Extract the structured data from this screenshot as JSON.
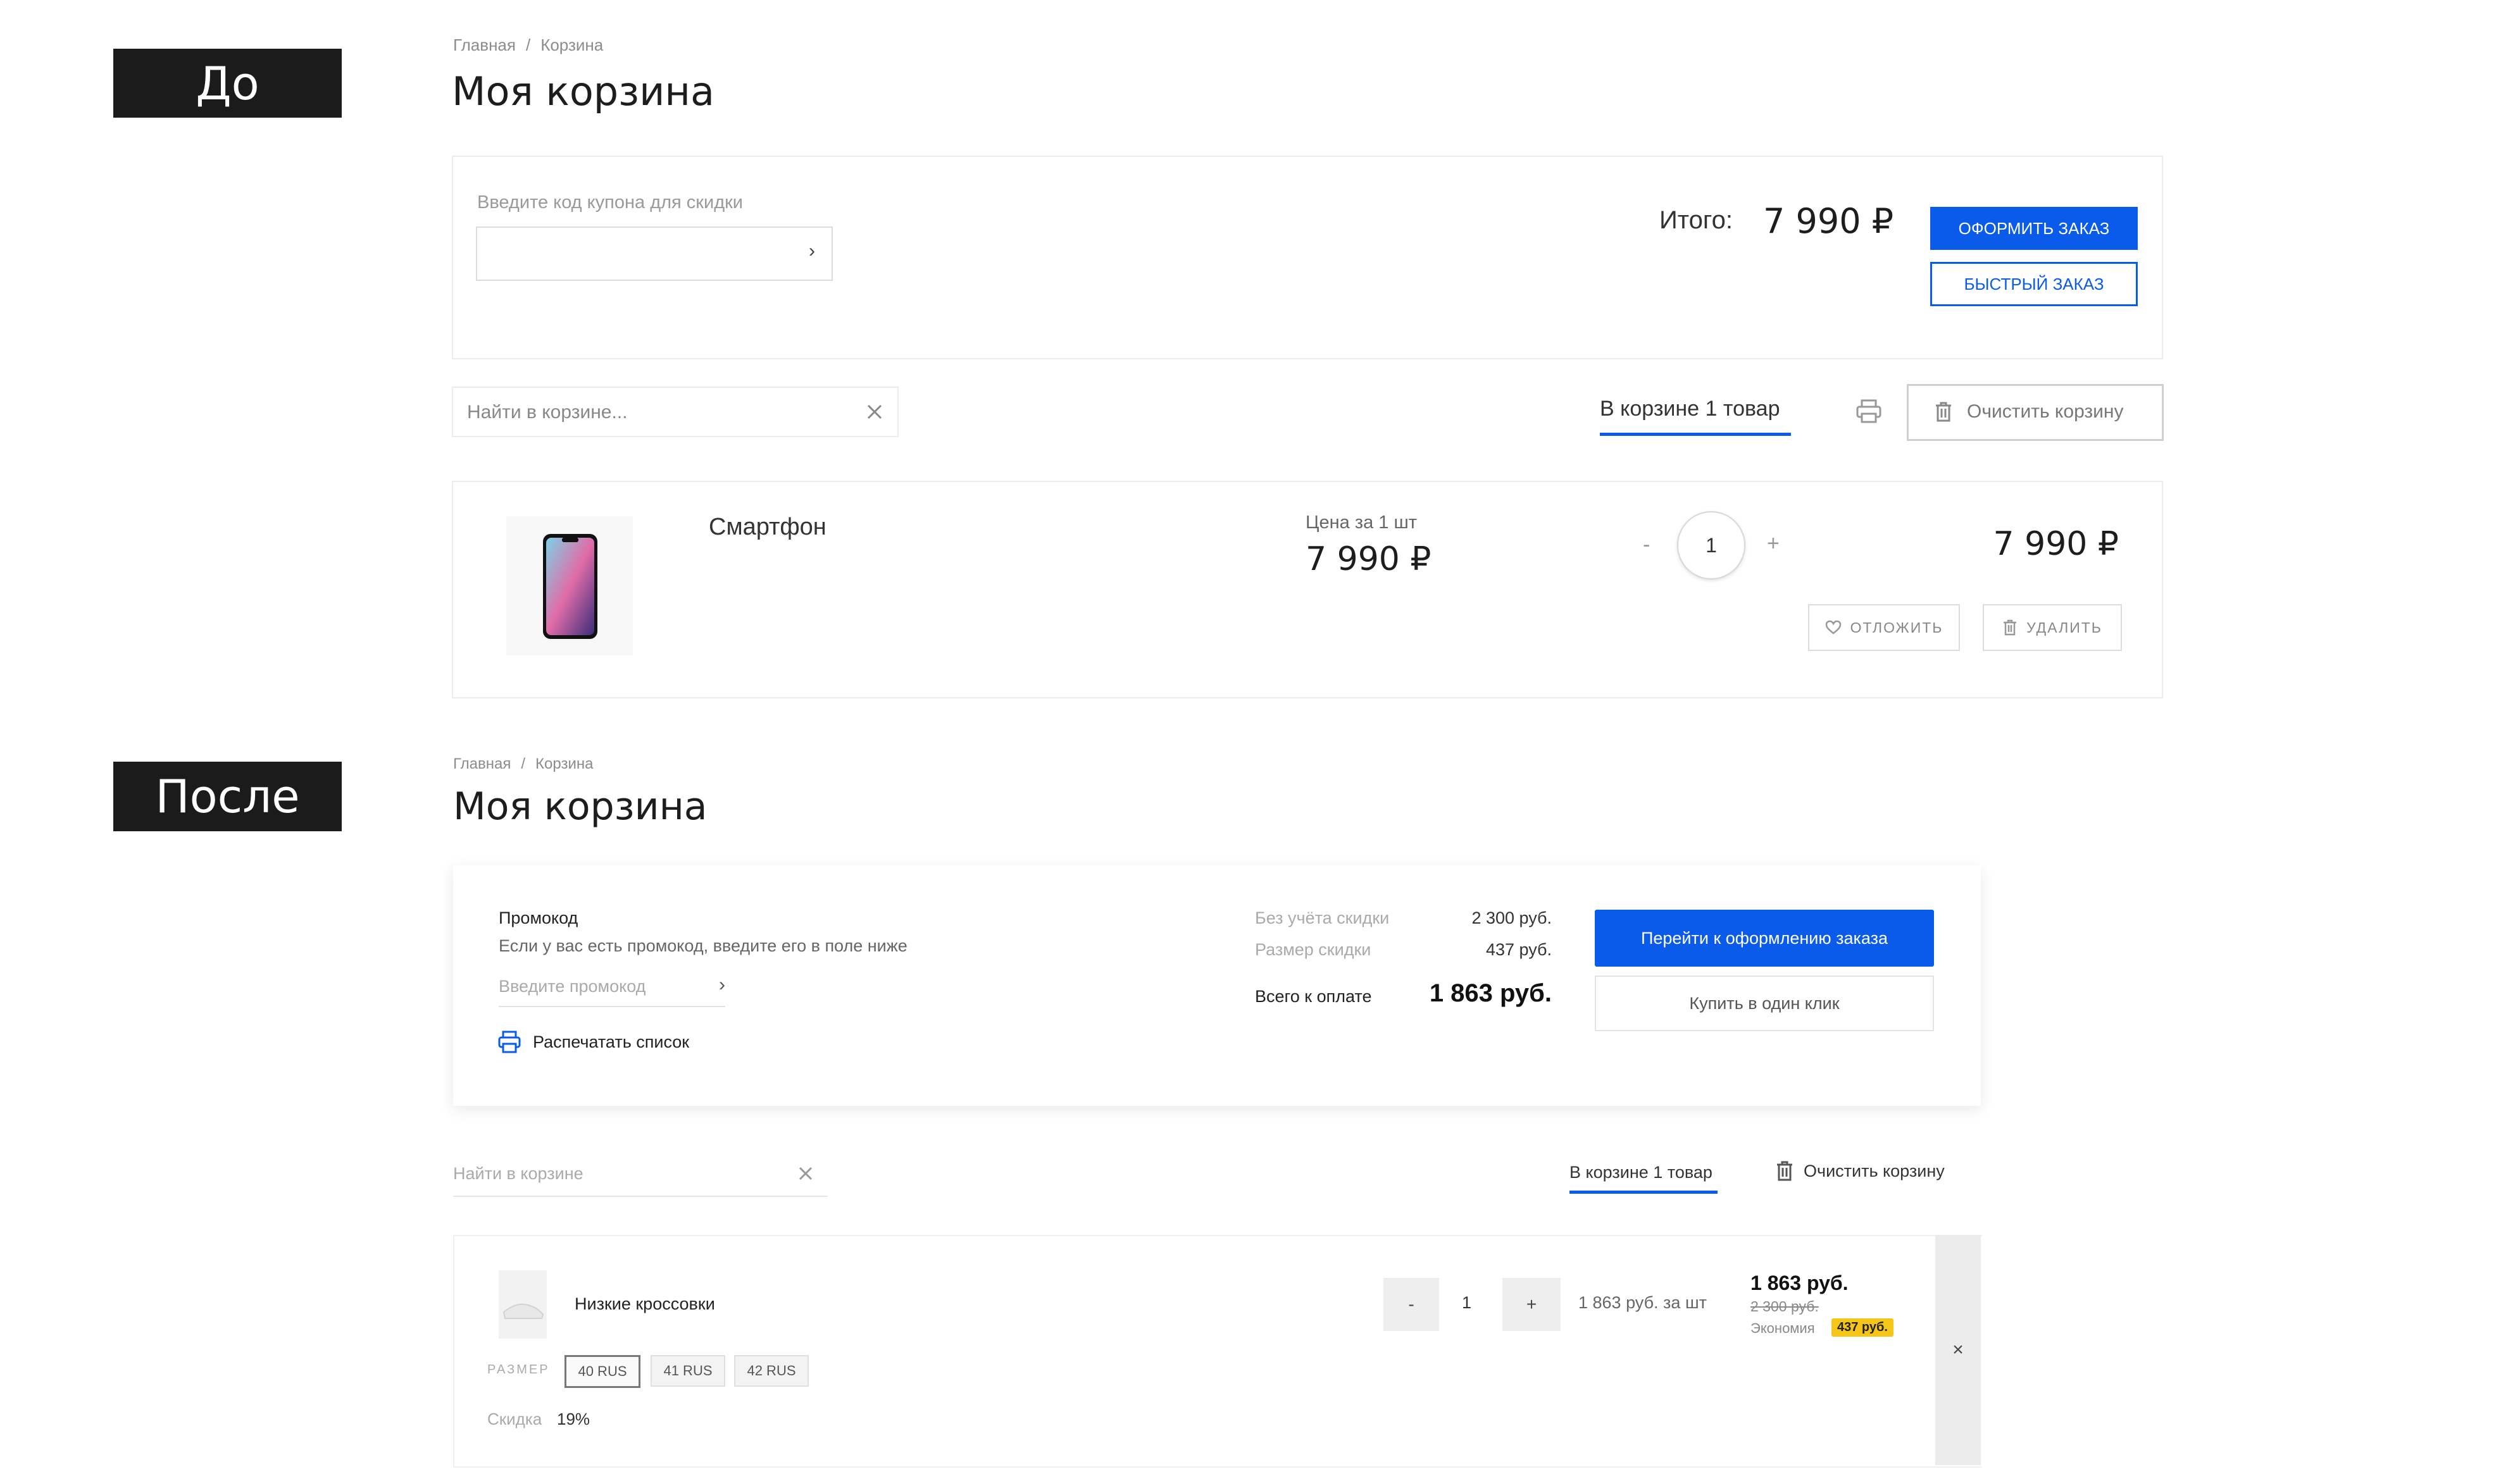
{
  "labels": {
    "before": "До",
    "after": "После"
  },
  "before": {
    "breadcrumbs": [
      "Главная",
      "Корзина"
    ],
    "title": "Моя корзина",
    "coupon": {
      "label": "Введите код купона для скидки",
      "value": ""
    },
    "total": {
      "label": "Итого:",
      "value": "7 990 ₽"
    },
    "buttons": {
      "checkout": "ОФОРМИТЬ ЗАКАЗ",
      "quick": "БЫСТРЫЙ ЗАКАЗ",
      "clear": "Очистить корзину",
      "postpone": "ОТЛОЖИТЬ",
      "remove": "УДАЛИТЬ"
    },
    "search": {
      "placeholder": "Найти в корзине..."
    },
    "cart_count": "В корзине 1 товар",
    "item": {
      "name": "Смартфон",
      "price_label": "Цена за 1 шт",
      "price": "7 990 ₽",
      "qty": "1",
      "minus": "-",
      "plus": "+",
      "total": "7 990 ₽"
    }
  },
  "after": {
    "breadcrumbs": [
      "Главная",
      "Корзина"
    ],
    "title": "Моя корзина",
    "promo": {
      "title": "Промокод",
      "hint": "Если у вас есть промокод, введите его в поле ниже",
      "placeholder": "Введите промокод",
      "print": "Распечатать список"
    },
    "summary": {
      "no_discount_label": "Без учёта скидки",
      "no_discount_value": "2 300 руб.",
      "discount_label": "Размер скидки",
      "discount_value": "437 руб.",
      "total_label": "Всего к оплате",
      "total_value": "1 863 руб."
    },
    "buttons": {
      "checkout": "Перейти к оформлению заказа",
      "one_click": "Купить в один клик",
      "clear": "Очистить корзину"
    },
    "search": {
      "placeholder": "Найти в корзине"
    },
    "cart_count": "В корзине 1 товар",
    "item": {
      "name": "Низкие кроссовки",
      "minus": "-",
      "qty": "1",
      "plus": "+",
      "unit_price": "1 863 руб. за шт",
      "price": "1 863 руб.",
      "old_price": "2 300 руб.",
      "economy_label": "Экономия",
      "economy_value": "437 руб.",
      "size_label": "РАЗМЕР",
      "sizes": [
        "40 RUS",
        "41 RUS",
        "42 RUS"
      ],
      "discount_label": "Скидка",
      "discount_value": "19%",
      "remove": "×"
    }
  },
  "colors": {
    "accent": "#0a5bea",
    "badge": "#f5c518",
    "dark_tag": "#1b1b1b"
  }
}
